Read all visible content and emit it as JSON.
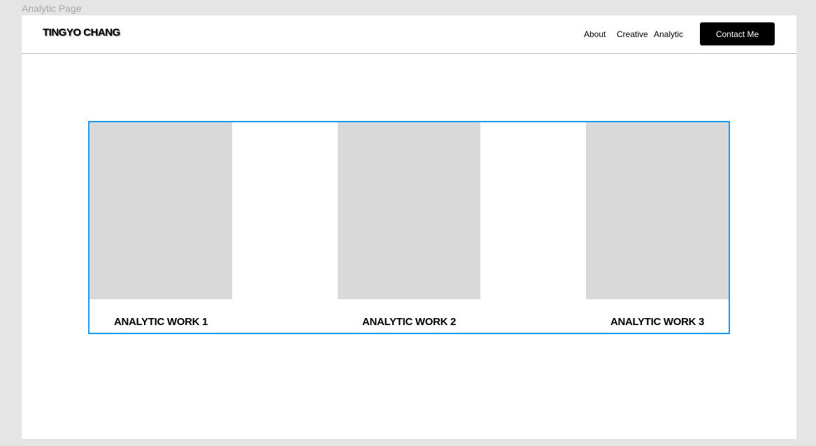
{
  "frame_label": "Analytic Page",
  "header": {
    "brand": "TINGYO CHANG",
    "nav": {
      "about": "About",
      "creative": "Creative",
      "analytic": "Analytic"
    },
    "cta_label": "Contact Me"
  },
  "works": [
    {
      "title": "ANALYTIC WORK 1"
    },
    {
      "title": "ANALYTIC WORK 2"
    },
    {
      "title": "ANALYTIC WORK 3"
    }
  ],
  "colors": {
    "selection": "#1e9bf0",
    "placeholder": "#d9d9d9",
    "canvas": "#e5e5e5"
  }
}
